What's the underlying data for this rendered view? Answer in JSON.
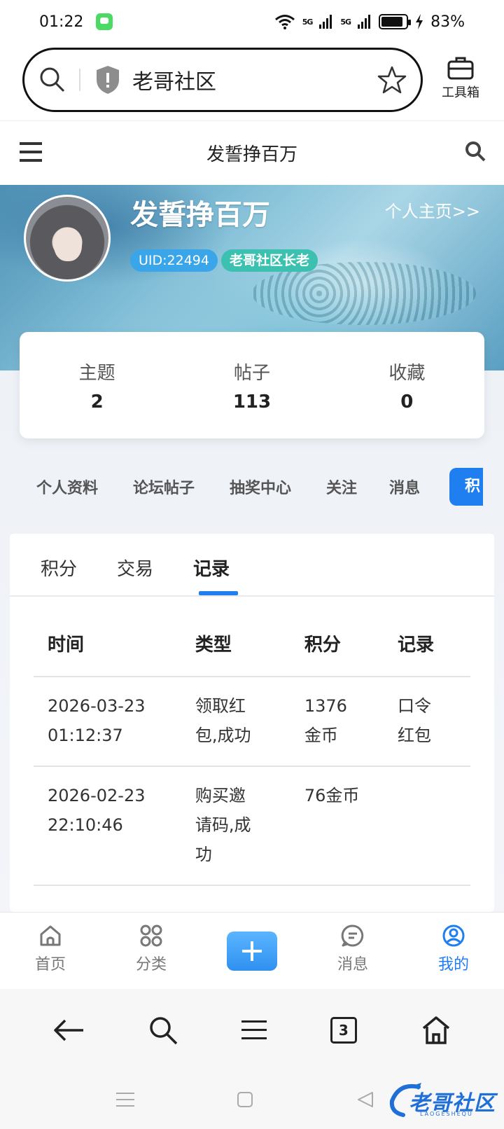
{
  "status_bar": {
    "time": "01:22",
    "network1": "5G",
    "network2": "5G",
    "battery": "83%"
  },
  "browser": {
    "url_text": "老哥社区",
    "toolbox_label": "工具箱",
    "tab_count": "3"
  },
  "page_header": {
    "title": "发誓挣百万"
  },
  "profile": {
    "name": "发誓挣百万",
    "home_link": "个人主页>>",
    "uid": "UID:22494",
    "role": "老哥社区长老"
  },
  "stats": [
    {
      "label": "主题",
      "value": "2"
    },
    {
      "label": "帖子",
      "value": "113"
    },
    {
      "label": "收藏",
      "value": "0"
    }
  ],
  "profile_tabs": [
    "个人资料",
    "论坛帖子",
    "抽奖中心",
    "关注",
    "消息"
  ],
  "profile_tab_active": "积",
  "sub_tabs": [
    "积分",
    "交易",
    "记录"
  ],
  "table": {
    "headers": [
      "时间",
      "类型",
      "积分",
      "记录"
    ],
    "rows": [
      {
        "time_date": "2026-03-23",
        "time_clock": "01:12:37",
        "type_l1": "领取红",
        "type_l2": "包,成功",
        "type_l3": "",
        "points_l1": "1376",
        "points_l2": "金币",
        "record_l1": "口令",
        "record_l2": "红包"
      },
      {
        "time_date": "2026-02-23",
        "time_clock": "22:10:46",
        "type_l1": "购买邀",
        "type_l2": "请码,成",
        "type_l3": "功",
        "points_l1": "76金币",
        "points_l2": "",
        "record_l1": "",
        "record_l2": ""
      }
    ]
  },
  "app_nav": [
    {
      "label": "首页",
      "icon": "home-icon"
    },
    {
      "label": "分类",
      "icon": "grid-icon"
    },
    {
      "label": "",
      "icon": "plus-icon"
    },
    {
      "label": "消息",
      "icon": "chat-icon"
    },
    {
      "label": "我的",
      "icon": "user-icon"
    }
  ],
  "logo": {
    "text": "老哥社区",
    "sub": "LAOGESHEQU"
  },
  "colors": {
    "accent": "#1f7ef0",
    "uid_badge": "#3aa5e8",
    "role_badge": "#3cc0b0"
  }
}
